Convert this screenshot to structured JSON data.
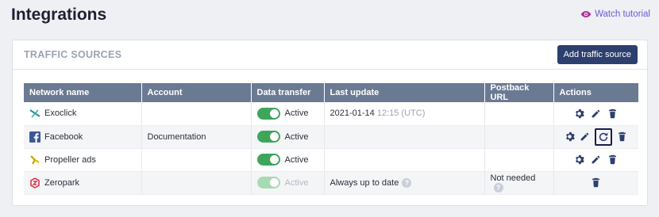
{
  "page": {
    "title": "Integrations",
    "watch_tutorial": "Watch tutorial"
  },
  "panel": {
    "title": "TRAFFIC SOURCES",
    "add_button": "Add traffic source"
  },
  "table": {
    "headers": [
      "Network name",
      "Account",
      "Data transfer",
      "Last update",
      "Postback URL",
      "Actions"
    ],
    "rows": [
      {
        "name": "Exoclick",
        "account": "",
        "transfer": "Active",
        "update_date": "2021-01-14",
        "update_time": "12:15 (UTC)",
        "postback": ""
      },
      {
        "name": "Facebook",
        "account": "Documentation",
        "transfer": "Active",
        "update_date": "",
        "update_time": "",
        "postback": ""
      },
      {
        "name": "Propeller ads",
        "account": "",
        "transfer": "Active",
        "update_date": "",
        "update_time": "",
        "postback": ""
      },
      {
        "name": "Zeropark",
        "account": "",
        "transfer": "Active",
        "update_text": "Always up to date",
        "postback": "Not needed"
      }
    ]
  },
  "colors": {
    "accent": "#2d3f6e",
    "header_bg": "#6b7a93",
    "toggle_on": "#3ea55a",
    "toggle_disabled": "#a8dab4",
    "link": "#6a5bd6"
  }
}
